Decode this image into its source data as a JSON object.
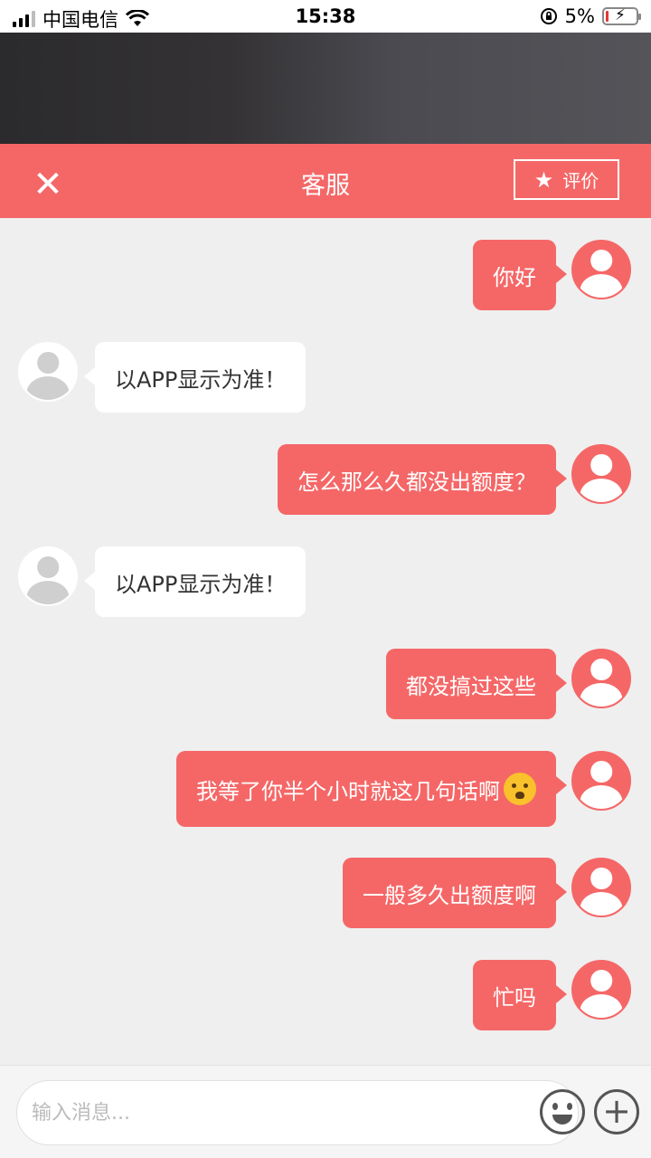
{
  "status_bar": {
    "carrier": "中国电信",
    "time": "15:38",
    "battery_percent": "5%",
    "signal_bars": 3,
    "icons": [
      "signal-icon",
      "wifi-icon",
      "rotation-lock-icon",
      "battery-icon"
    ]
  },
  "header": {
    "title": "客服",
    "close_icon": "✕",
    "rate_label": "评价",
    "rate_icon": "★"
  },
  "messages": [
    {
      "from": "user",
      "text": "你好"
    },
    {
      "from": "agent",
      "text": "以APP显示为准！"
    },
    {
      "from": "user",
      "text": "怎么那么久都没出额度？"
    },
    {
      "from": "agent",
      "text": "以APP显示为准！"
    },
    {
      "from": "user",
      "text": "都没搞过这些"
    },
    {
      "from": "user",
      "text": "我等了你半个小时就这几句话啊",
      "emoji": "anguished-face-emoji"
    },
    {
      "from": "user",
      "text": "一般多久出额度啊"
    },
    {
      "from": "user",
      "text": "忙吗"
    }
  ],
  "input": {
    "placeholder": "输入消息...",
    "value": "",
    "plus_icon": "+"
  },
  "colors": {
    "accent": "#f56767",
    "background": "#efefef",
    "agent_bubble": "#ffffff"
  }
}
